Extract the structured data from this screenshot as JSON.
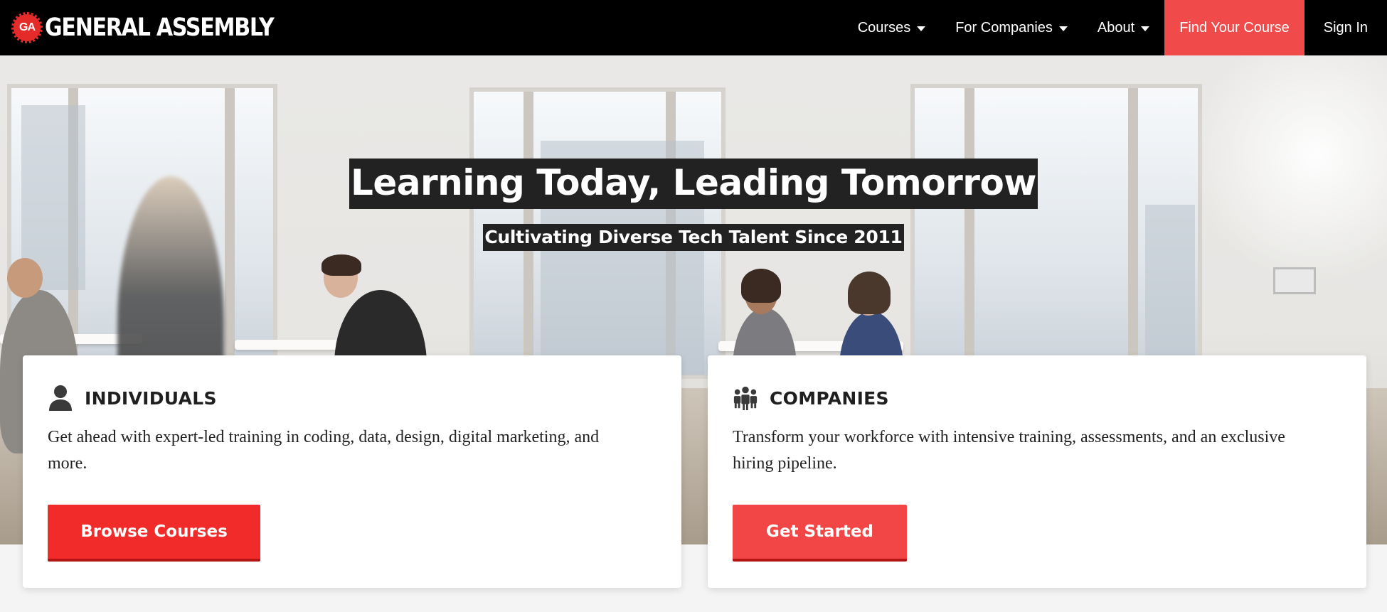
{
  "brand": {
    "badge": "GA",
    "name": "GENERAL ASSEMBLY",
    "accent": "#e52b29"
  },
  "nav": {
    "items": [
      {
        "label": "Courses",
        "dropdown": true
      },
      {
        "label": "For Companies",
        "dropdown": true
      },
      {
        "label": "About",
        "dropdown": true
      }
    ],
    "cta": "Find Your Course",
    "signin": "Sign In",
    "cta_color": "#f14a4a"
  },
  "hero": {
    "title": "Learning Today, Leading Tomorrow",
    "subtitle": "Cultivating Diverse Tech Talent Since 2011"
  },
  "cards": [
    {
      "icon": "person-icon",
      "title": "INDIVIDUALS",
      "description": "Get ahead with expert-led training in coding, data, design, digital marketing, and more.",
      "button": "Browse Courses"
    },
    {
      "icon": "group-icon",
      "title": "COMPANIES",
      "description": "Transform your workforce with intensive training, assessments, and an exclusive hiring pipeline.",
      "button": "Get Started"
    }
  ]
}
